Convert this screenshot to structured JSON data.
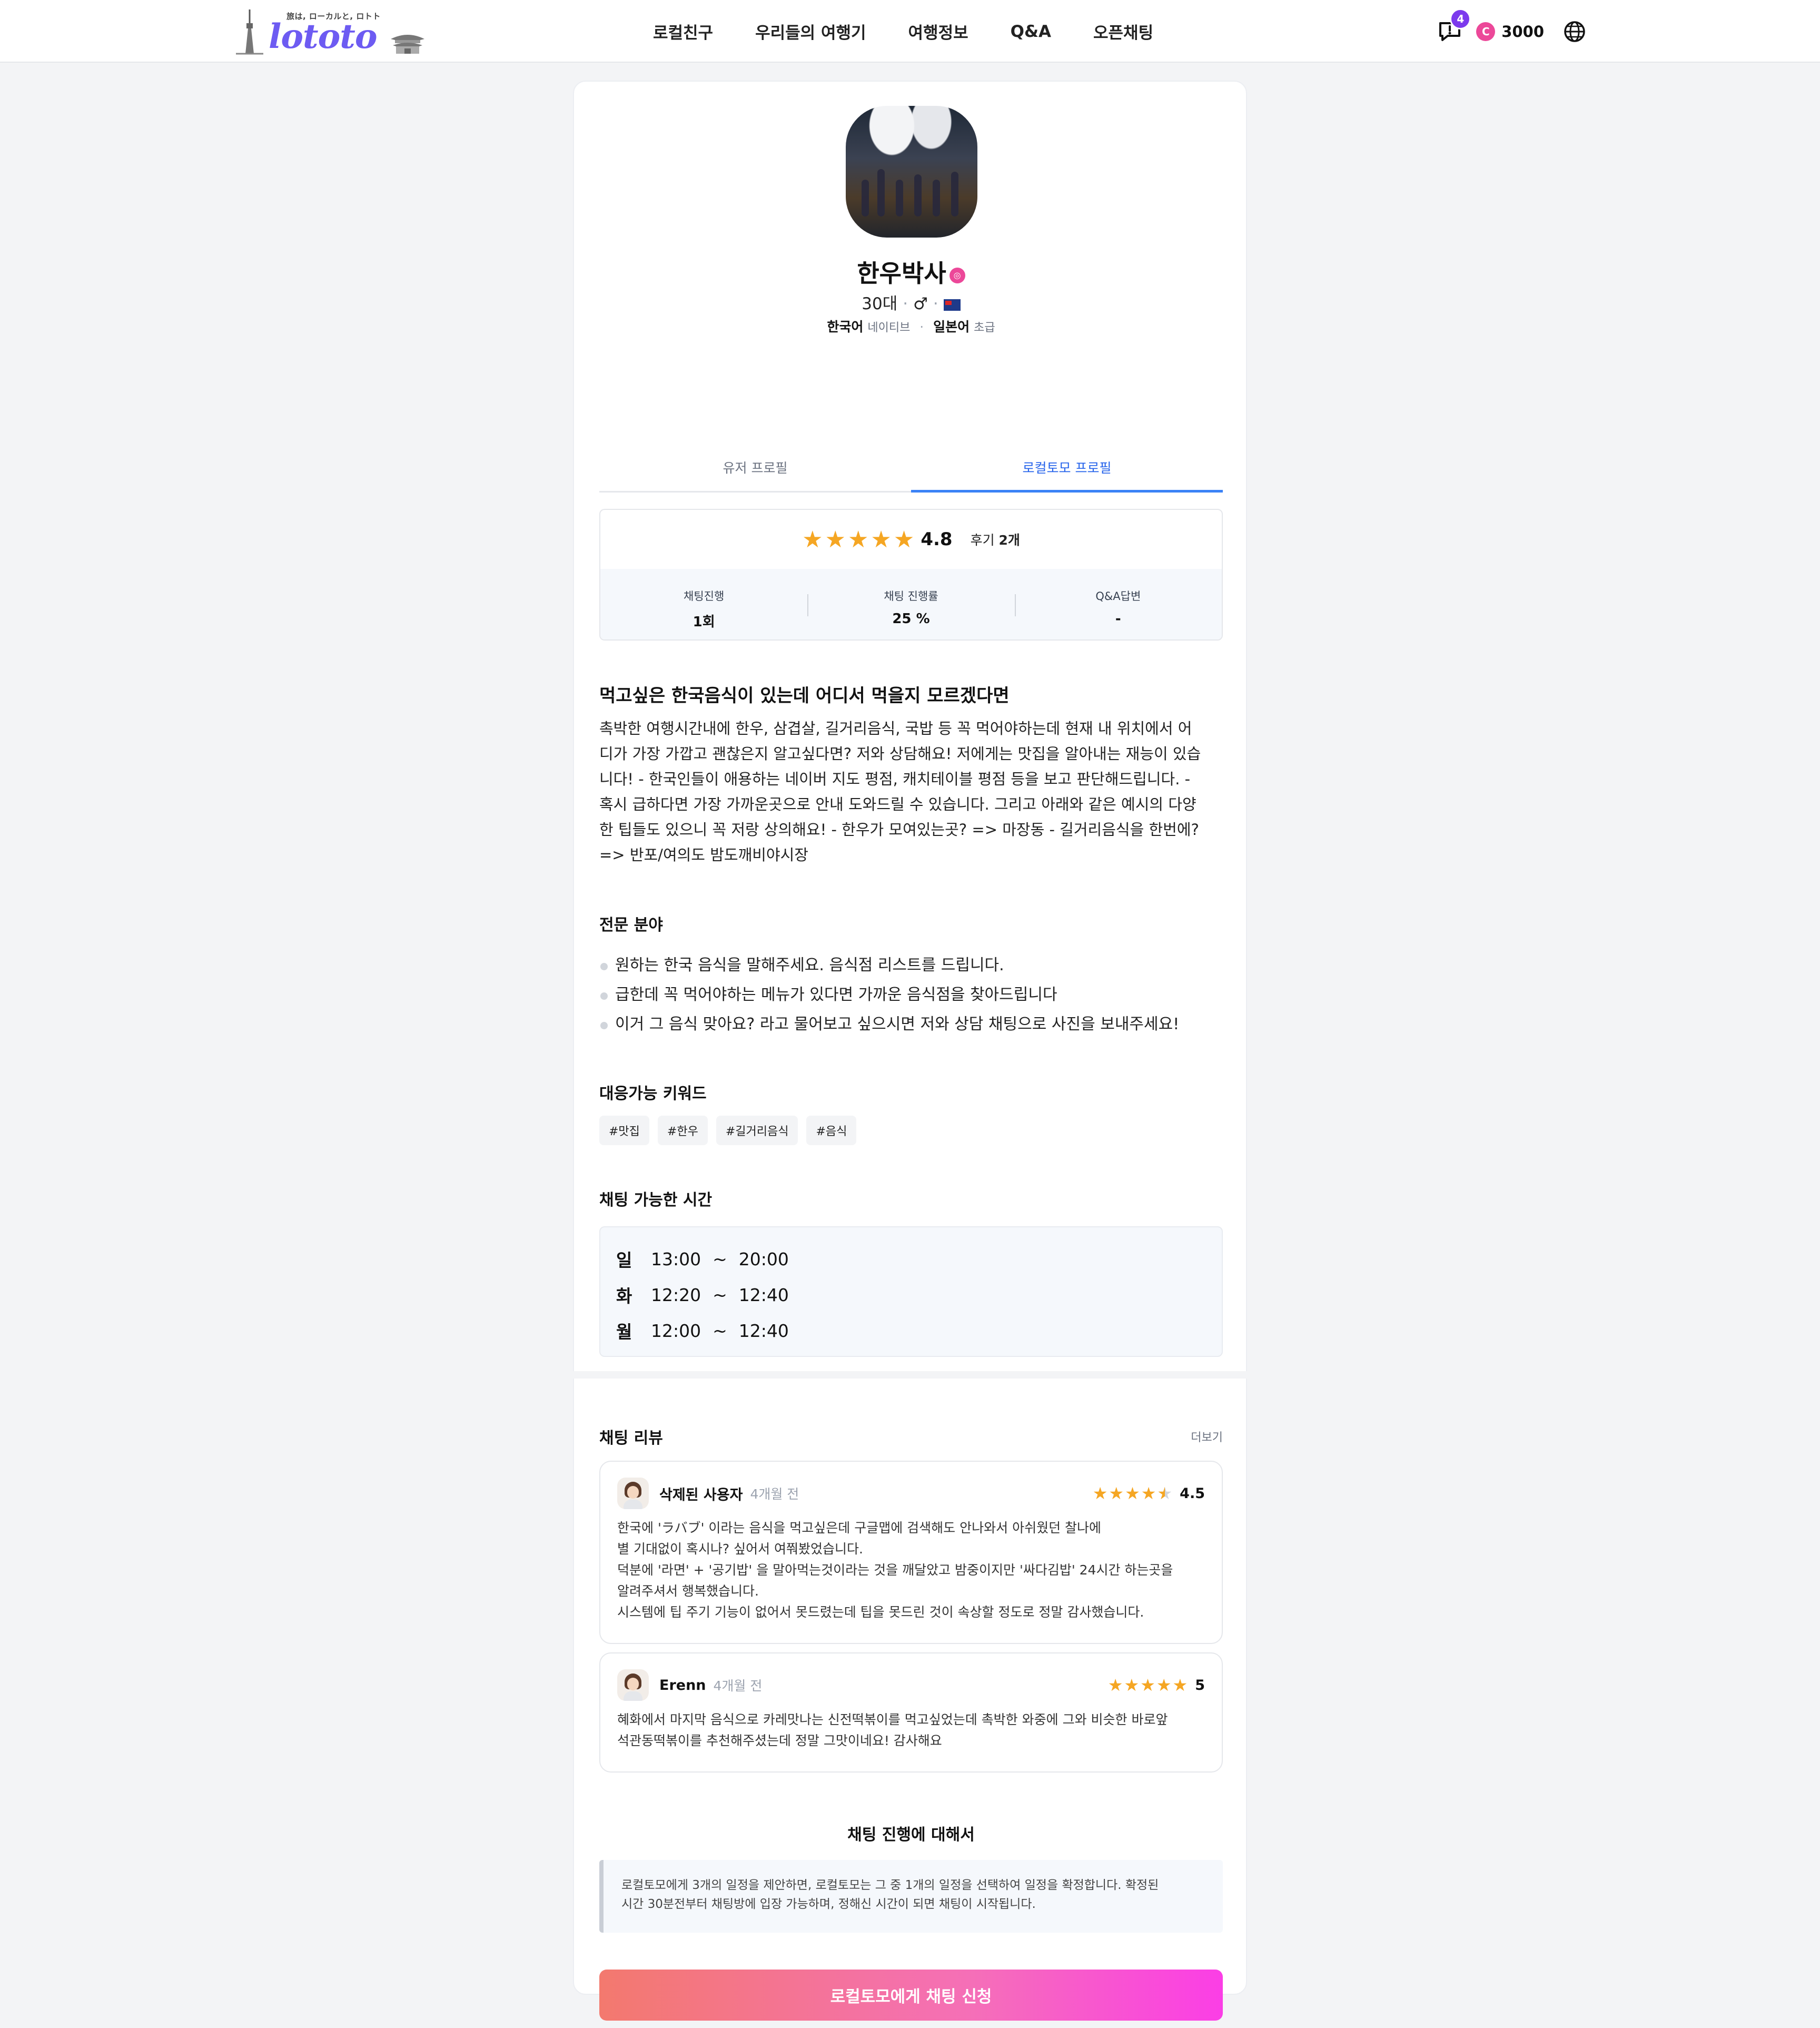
{
  "header": {
    "logo_tagline": "旅は, ローカルと, ロトト",
    "logo_text": "lototo",
    "nav": [
      "로컬친구",
      "우리들의 여행기",
      "여행정보",
      "Q&A",
      "오픈채팅"
    ],
    "notification_count": "4",
    "coin_symbol": "C",
    "coin_amount": "3000"
  },
  "profile": {
    "name": "한우박사",
    "verified_icon": "instagram-icon",
    "age": "30대",
    "gender": "♂",
    "country_flag": "australia-flag-icon",
    "languages": [
      {
        "name": "한국어",
        "level": "네이티브"
      },
      {
        "name": "일본어",
        "level": "초급"
      }
    ]
  },
  "tabs": [
    {
      "label": "유저 프로필",
      "active": false
    },
    {
      "label": "로컬토모 프로필",
      "active": true
    }
  ],
  "rating": {
    "stars": 5,
    "score": "4.8",
    "review_label": "후기",
    "review_count": "2개",
    "star_color": "#f5a623"
  },
  "stats": [
    {
      "label": "채팅진행",
      "value": "1회"
    },
    {
      "label": "채팅 진행률",
      "value": "25 %"
    },
    {
      "label": "Q&A답변",
      "value": "-"
    }
  ],
  "intro": {
    "title": "먹고싶은 한국음식이 있는데 어디서 먹을지 모르겠다면",
    "lines": [
      "촉박한 여행시간내에 한우, 삼겹살, 길거리음식, 국밥 등 꼭 먹어야하는데 현재 내 위치에서 어",
      "디가 가장 가깝고 괜찮은지 알고싶다면? 저와 상담해요! 저에게는 맛집을 알아내는 재능이 있습",
      "니다! - 한국인들이 애용하는 네이버 지도 평점, 캐치테이블 평점 등을 보고 판단해드립니다. -",
      "혹시 급하다면 가장 가까운곳으로 안내 도와드릴 수 있습니다. 그리고 아래와 같은 예시의 다양",
      "한 팁들도 있으니 꼭 저랑 상의해요! - 한우가 모여있는곳? => 마장동 - 길거리음식을 한번에?",
      "=> 반포/여의도 밤도깨비야시장"
    ]
  },
  "expertise": {
    "title": "전문 분야",
    "items": [
      "원하는 한국 음식을 말해주세요. 음식점 리스트를 드립니다.",
      "급한데 꼭 먹어야하는 메뉴가 있다면 가까운 음식점을 찾아드립니다",
      "이거 그 음식 맞아요? 라고 물어보고 싶으시면 저와 상담 채팅으로 사진을 보내주세요!"
    ]
  },
  "keywords": {
    "title": "대응가능 키워드",
    "tags": [
      "#맛집",
      "#한우",
      "#길거리음식",
      "#음식"
    ]
  },
  "schedule": {
    "title": "채팅 가능한 시간",
    "rows": [
      {
        "day": "일",
        "start": "13:00",
        "sep": "~",
        "end": "20:00"
      },
      {
        "day": "화",
        "start": "12:20",
        "sep": "~",
        "end": "12:40"
      },
      {
        "day": "월",
        "start": "12:00",
        "sep": "~",
        "end": "12:40"
      }
    ]
  },
  "reviews": {
    "title": "채팅 리뷰",
    "more": "더보기",
    "items": [
      {
        "name": "삭제된 사용자",
        "date": "4개월 전",
        "stars": 4.5,
        "score": "4.5",
        "text": "한국에 'ラバブ' 이라는 음식을 먹고싶은데 구글맵에 검색해도 안나와서 아쉬웠던 찰나에\n별 기대없이 혹시나? 싶어서 여쭤봤었습니다.\n덕분에 '라면' + '공기밥' 을 말아먹는것이라는 것을 깨달았고 밤중이지만 '싸다김밥' 24시간 하는곳을\n알려주셔서 행복했습니다.\n시스템에 팁 주기 기능이 없어서 못드렸는데 팁을 못드린 것이 속상할 정도로 정말 감사했습니다."
      },
      {
        "name": "Erenn",
        "date": "4개월 전",
        "stars": 5,
        "score": "5",
        "text": "혜화에서 마지막 음식으로 카레맛나는 신전떡볶이를 먹고싶었는데 촉박한 와중에 그와 비슷한 바로앞\n석관동떡볶이를 추천해주셨는데 정말 그맛이네요! 감사해요"
      }
    ]
  },
  "about": {
    "title": "채팅 진행에 대해서",
    "lines": [
      "로컬토모에게 3개의 일정을 제안하면, 로컬토모는 그 중 1개의 일정을 선택하여 일정을 확정합니다. 확정된",
      "시간 30분전부터 채팅방에 입장 가능하며, 정해신 시간이 되면 채팅이 시작됩니다."
    ]
  },
  "cta": {
    "label": "로컬토모에게 채팅 신청",
    "gradient_start": "#f3796e",
    "gradient_end": "#fb3ee6"
  }
}
